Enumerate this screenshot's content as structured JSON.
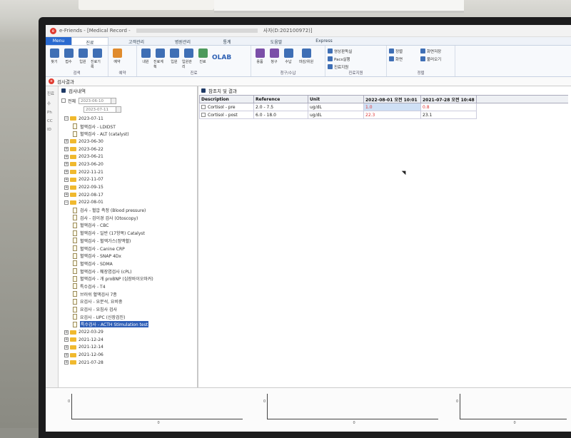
{
  "window": {
    "app_title_prefix": "e-Friends - [Medical Record -",
    "app_title_suffix": "사자(D:202100972)]"
  },
  "ribbon": {
    "menu_label": "Menu",
    "tabs": [
      "진료",
      "고객관리",
      "병원관리",
      "통계",
      "도움말",
      "Express"
    ],
    "groups": [
      {
        "label": "검색",
        "buttons": [
          "찾기",
          "접수",
          "입원",
          "진료기록"
        ]
      },
      {
        "label": "예약",
        "buttons": [
          "예약"
        ]
      },
      {
        "label": "진료",
        "buttons": [
          "내원",
          "진료계획",
          "입원",
          "입원관리",
          "진료"
        ]
      },
      {
        "label": "청구/수납",
        "buttons": [
          "용품",
          "청구",
          "수납",
          "마감/위원"
        ]
      },
      {
        "label": "진료지원",
        "buttons": [
          "영상판독실",
          "Pacs실행",
          "진료지원"
        ]
      },
      {
        "label": "정렬",
        "buttons": [
          "정렬",
          "화면",
          "화면저장",
          "불러오기"
        ]
      }
    ],
    "olab_label": "OLAB"
  },
  "doc_tab": {
    "label": "검사결과"
  },
  "left_strip_labels": [
    "진료",
    "수",
    "Ph",
    "CC",
    "ID"
  ],
  "left_panel": {
    "header": "검사내역",
    "all_label": "전체",
    "date_from": "2023-06-10",
    "date_to": "2023-07-11",
    "tree": [
      {
        "type": "folder",
        "expanded": true,
        "label": "2023-07-11"
      },
      {
        "type": "item",
        "label": "혈액검사 - LDIDST"
      },
      {
        "type": "item",
        "label": "혈액검사 - ALT (catalyst)"
      },
      {
        "type": "folder",
        "expanded": false,
        "label": "2023-06-30"
      },
      {
        "type": "folder",
        "expanded": false,
        "label": "2023-06-22"
      },
      {
        "type": "folder",
        "expanded": false,
        "label": "2023-06-21"
      },
      {
        "type": "folder",
        "expanded": false,
        "label": "2023-06-20"
      },
      {
        "type": "folder",
        "expanded": false,
        "label": "2022-11-21"
      },
      {
        "type": "folder",
        "expanded": false,
        "label": "2022-11-07"
      },
      {
        "type": "folder",
        "expanded": false,
        "label": "2022-09-15"
      },
      {
        "type": "folder",
        "expanded": false,
        "label": "2022-08-17"
      },
      {
        "type": "folder",
        "expanded": true,
        "label": "2022-08-01"
      },
      {
        "type": "item",
        "label": "검사 - 혈압 측정 (Blood pressure)"
      },
      {
        "type": "item",
        "label": "검사 - 검이경 검사 (Otoscopy)"
      },
      {
        "type": "item",
        "label": "혈액검사 - CBC"
      },
      {
        "type": "item",
        "label": "혈액검사 - 일반 (17항목) Catalyst"
      },
      {
        "type": "item",
        "label": "혈액검사 - 혈액가스(정맥혈)"
      },
      {
        "type": "item",
        "label": "혈액검사 - Canine CRP"
      },
      {
        "type": "item",
        "label": "혈액검사 - SNAP 4Dx"
      },
      {
        "type": "item",
        "label": "혈액검사 - SDMA"
      },
      {
        "type": "item",
        "label": "혈액검사 - 췌장염검사 (cPL)"
      },
      {
        "type": "item",
        "label": "혈액검사 - 개 proBNP (심장바이오마커)"
      },
      {
        "type": "item",
        "label": "특수검사 - T4"
      },
      {
        "type": "item",
        "label": "브러쉬 혈액검사 7종"
      },
      {
        "type": "item",
        "label": "요검사 - 요분석, 요비중"
      },
      {
        "type": "item",
        "label": "요검사 - 요침사 검사"
      },
      {
        "type": "item",
        "label": "요검사 - UPC (신장검진)"
      },
      {
        "type": "item",
        "label": "특수검사 - ACTH Stimulation test",
        "selected": true
      },
      {
        "type": "folder",
        "expanded": false,
        "label": "2022-03-29"
      },
      {
        "type": "folder",
        "expanded": false,
        "label": "2021-12-24"
      },
      {
        "type": "folder",
        "expanded": false,
        "label": "2021-12-14"
      },
      {
        "type": "folder",
        "expanded": false,
        "label": "2021-12-06"
      },
      {
        "type": "folder",
        "expanded": false,
        "label": "2021-07-28"
      }
    ]
  },
  "right_panel": {
    "header": "참조치 및 결과",
    "columns": [
      "Description",
      "Reference",
      "Unit",
      "2022-08-01 오전 10:01",
      "2021-07-28 오전 10:48"
    ],
    "rows": [
      {
        "description": "Cortisol - pre",
        "reference": "2.0 - 7.5",
        "unit": "ug/dL",
        "v1": "1.0",
        "v2": "0.8"
      },
      {
        "description": "Cortisol - post",
        "reference": "6.0 - 18.0",
        "unit": "ug/dL",
        "v1": "22.3",
        "v2": "23.1"
      }
    ]
  },
  "mini_charts": {
    "y_tick": "0",
    "x_tick": "0"
  },
  "colors": {
    "accent": "#2a6ad0",
    "selected": "#2f5fb7",
    "abnormal": "#d33333",
    "folder": "#f0b92e"
  }
}
